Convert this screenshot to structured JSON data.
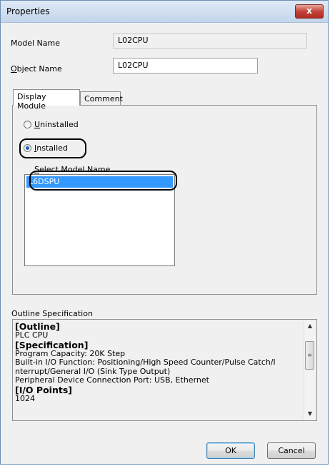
{
  "window": {
    "title": "Properties",
    "close_glyph": "x"
  },
  "model_name": {
    "label": "Model Name",
    "value": "L02CPU"
  },
  "object_name": {
    "label_underlined": "O",
    "label_rest": "bject Name",
    "value": "L02CPU"
  },
  "tabs": [
    {
      "label": "Display Module"
    },
    {
      "label": "Comment"
    }
  ],
  "display_module": {
    "uninstalled": {
      "underlined": "U",
      "rest": "ninstalled",
      "selected": false
    },
    "installed": {
      "underlined": "I",
      "rest": "nstalled",
      "selected": true
    },
    "select_label_underlined": "S",
    "select_label_rest": "elect Model Name",
    "list_items": [
      "L6DSPU"
    ]
  },
  "outline": {
    "label": "Outline Specification",
    "lines": [
      {
        "text": "[Outline]",
        "bold": true
      },
      {
        "text": "PLC CPU",
        "bold": false
      },
      {
        "text": "[Specification]",
        "bold": true
      },
      {
        "text": "Program Capacity: 20K Step",
        "bold": false
      },
      {
        "text": "Built-in I/O Function: Positioning/High Speed Counter/Pulse Catch/I",
        "bold": false
      },
      {
        "text": "nterrupt/General I/O (Sink Type Output)",
        "bold": false
      },
      {
        "text": "Peripheral Device Connection Port: USB, Ethernet",
        "bold": false
      },
      {
        "text": "[I/O Points]",
        "bold": true
      },
      {
        "text": "1024",
        "bold": false
      }
    ]
  },
  "buttons": {
    "ok": "OK",
    "cancel": "Cancel"
  },
  "colors": {
    "selection": "#3399ff",
    "close_button": "#c4423a",
    "title_bar": "#c3d5eb"
  }
}
